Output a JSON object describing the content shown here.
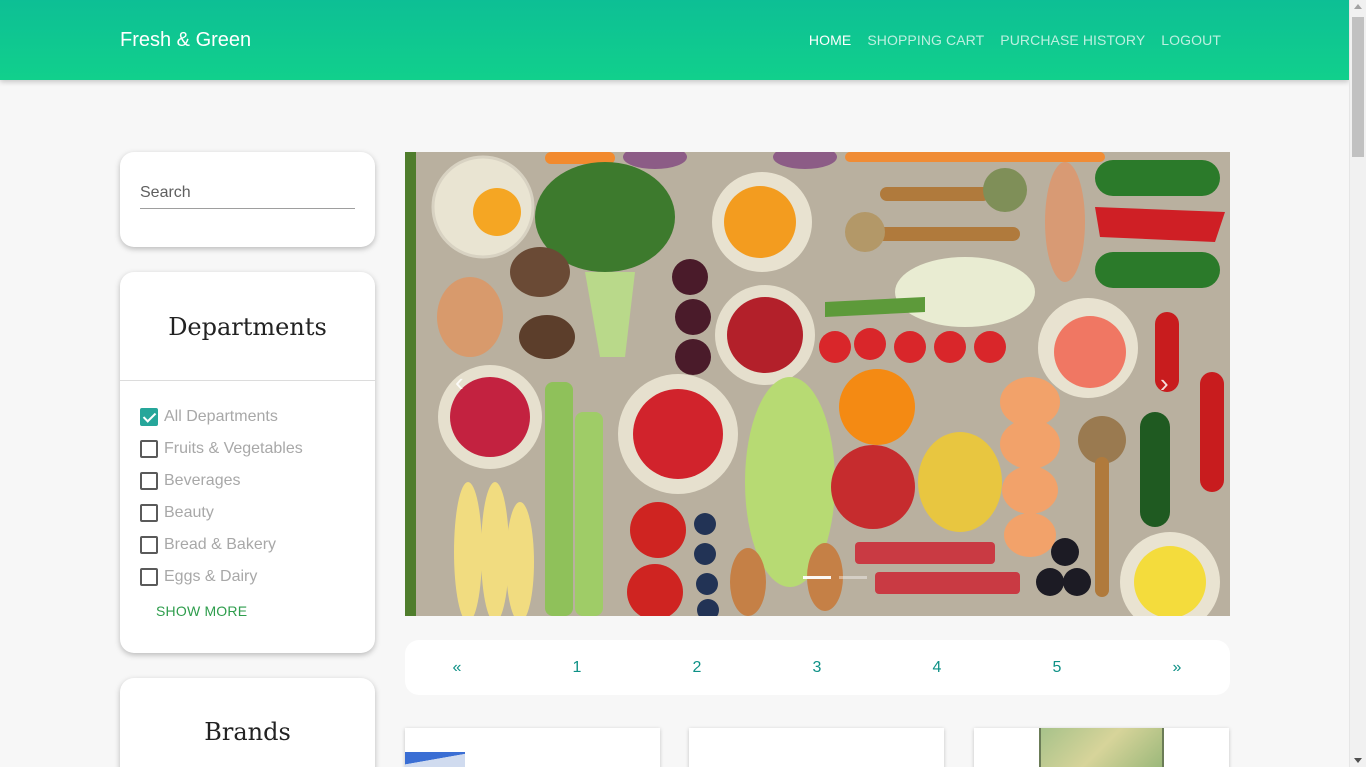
{
  "navbar": {
    "brand": "Fresh & Green",
    "links": [
      {
        "label": "HOME",
        "active": true
      },
      {
        "label": "SHOPPING CART",
        "active": false
      },
      {
        "label": "PURCHASE HISTORY",
        "active": false
      },
      {
        "label": "LOGOUT",
        "active": false
      }
    ]
  },
  "search": {
    "placeholder": "Search",
    "value": ""
  },
  "departments": {
    "title": "Departments",
    "items": [
      {
        "label": "All Departments",
        "checked": true
      },
      {
        "label": "Fruits & Vegetables",
        "checked": false
      },
      {
        "label": "Beverages",
        "checked": false
      },
      {
        "label": "Beauty",
        "checked": false
      },
      {
        "label": "Bread & Bakery",
        "checked": false
      },
      {
        "label": "Eggs & Dairy",
        "checked": false
      }
    ],
    "show_more": "SHOW MORE"
  },
  "brands": {
    "title": "Brands"
  },
  "carousel": {
    "image_icon": "fresh-produce-flatlay-image",
    "prev_icon": "‹",
    "next_icon": "›",
    "slide_count": 2,
    "active_slide": 1
  },
  "pagination": [
    "«",
    "1",
    "2",
    "3",
    "4",
    "5",
    "»"
  ],
  "colors": {
    "nav_gradient_start": "#0dbf95",
    "nav_gradient_end": "#11d08c",
    "accent_teal": "#26a69a",
    "pagination_text": "#0e9186",
    "show_more_green": "#2e9d4c"
  }
}
